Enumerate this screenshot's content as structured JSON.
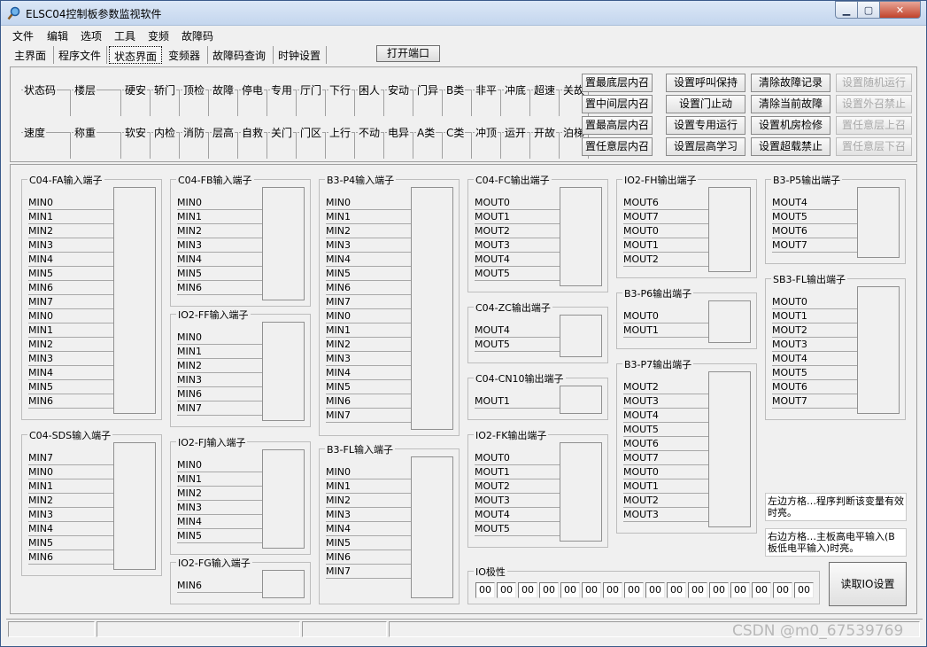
{
  "title": "ELSC04控制板参数监视软件",
  "menu": [
    "文件",
    "编辑",
    "选项",
    "工具",
    "变频",
    "故障码"
  ],
  "tabs": [
    "主界面",
    "程序文件",
    "状态界面",
    "变频器",
    "故障码查询",
    "时钟设置"
  ],
  "active_tab": "状态界面",
  "open_port": "打开端口",
  "status_row1": [
    "状态码",
    "楼层",
    "硬安",
    "轿门",
    "顶检",
    "故障",
    "停电",
    "专用",
    "厅门",
    "下行",
    "困人",
    "安动",
    "门异",
    "B类",
    "非平",
    "冲底",
    "超速",
    "关故"
  ],
  "status_row2": [
    "速度",
    "称重",
    "软安",
    "内检",
    "消防",
    "层高",
    "自救",
    "关门",
    "门区",
    "上行",
    "不动",
    "电异",
    "A类",
    "C类",
    "冲顶",
    "运开",
    "开故",
    "泊梯"
  ],
  "buttons_col1": [
    "置最底层内召",
    "置中间层内召",
    "置最高层内召",
    "置任意层内召"
  ],
  "buttons_col2": [
    "设置呼叫保持",
    "设置门止动",
    "设置专用运行",
    "设置层高学习"
  ],
  "buttons_col3": [
    "清除故障记录",
    "清除当前故障",
    "设置机房检修",
    "设置超载禁止"
  ],
  "buttons_col4": [
    "设置随机运行",
    "设置外召禁止",
    "置任意层上召",
    "置任意层下召"
  ],
  "groups": {
    "c04fa": {
      "title": "C04-FA输入端子",
      "pins": [
        "MIN0",
        "MIN1",
        "MIN2",
        "MIN3",
        "MIN4",
        "MIN5",
        "MIN6",
        "MIN7",
        "MIN0",
        "MIN1",
        "MIN2",
        "MIN3",
        "MIN4",
        "MIN5",
        "MIN6"
      ]
    },
    "c04sds": {
      "title": "C04-SDS输入端子",
      "pins": [
        "MIN7",
        "MIN0",
        "MIN1",
        "MIN2",
        "MIN3",
        "MIN4",
        "MIN5",
        "MIN6"
      ]
    },
    "c04fb": {
      "title": "C04-FB输入端子",
      "pins": [
        "MIN0",
        "MIN1",
        "MIN2",
        "MIN3",
        "MIN4",
        "MIN5",
        "MIN6"
      ]
    },
    "io2ff": {
      "title": "IO2-FF输入端子",
      "pins": [
        "MIN0",
        "MIN1",
        "MIN2",
        "MIN3",
        "MIN6",
        "MIN7"
      ]
    },
    "io2fj": {
      "title": "IO2-FJ输入端子",
      "pins": [
        "MIN0",
        "MIN1",
        "MIN2",
        "MIN3",
        "MIN4",
        "MIN5"
      ]
    },
    "io2fg": {
      "title": "IO2-FG输入端子",
      "pins": [
        "MIN6"
      ]
    },
    "b3p4": {
      "title": "B3-P4输入端子",
      "pins": [
        "MIN0",
        "MIN1",
        "MIN2",
        "MIN3",
        "MIN4",
        "MIN5",
        "MIN6",
        "MIN7",
        "MIN0",
        "MIN1",
        "MIN2",
        "MIN3",
        "MIN4",
        "MIN5",
        "MIN6",
        "MIN7"
      ]
    },
    "b3fl": {
      "title": "B3-FL输入端子",
      "pins": [
        "MIN0",
        "MIN1",
        "MIN2",
        "MIN3",
        "MIN4",
        "MIN5",
        "MIN6",
        "MIN7"
      ]
    },
    "c04fc": {
      "title": "C04-FC输出端子",
      "pins": [
        "MOUT0",
        "MOUT1",
        "MOUT2",
        "MOUT3",
        "MOUT4",
        "MOUT5"
      ]
    },
    "c04zc": {
      "title": "C04-ZC输出端子",
      "pins": [
        "MOUT4",
        "MOUT5"
      ]
    },
    "c04cn10": {
      "title": "C04-CN10输出端子",
      "pins": [
        "MOUT1"
      ]
    },
    "io2fk": {
      "title": "IO2-FK输出端子",
      "pins": [
        "MOUT0",
        "MOUT1",
        "MOUT2",
        "MOUT3",
        "MOUT4",
        "MOUT5"
      ]
    },
    "io2fh": {
      "title": "IO2-FH输出端子",
      "pins": [
        "MOUT6",
        "MOUT7",
        "MOUT0",
        "MOUT1",
        "MOUT2"
      ]
    },
    "b3p6": {
      "title": "B3-P6输出端子",
      "pins": [
        "MOUT0",
        "MOUT1"
      ]
    },
    "b3p7": {
      "title": "B3-P7输出端子",
      "pins": [
        "MOUT2",
        "MOUT3",
        "MOUT4",
        "MOUT5",
        "MOUT6",
        "MOUT7",
        "MOUT0",
        "MOUT1",
        "MOUT2",
        "MOUT3"
      ]
    },
    "b3p5": {
      "title": "B3-P5输出端子",
      "pins": [
        "MOUT4",
        "MOUT5",
        "MOUT6",
        "MOUT7"
      ]
    },
    "sb3fl": {
      "title": "SB3-FL输出端子",
      "pins": [
        "MOUT0",
        "MOUT1",
        "MOUT2",
        "MOUT3",
        "MOUT4",
        "MOUT5",
        "MOUT6",
        "MOUT7"
      ]
    }
  },
  "note1": "左边方格…程序判断该变量有效时亮。",
  "note2": "右边方格…主板高电平输入(B板低电平输入)时亮。",
  "io_polarity": {
    "title": "IO极性",
    "values": [
      "00",
      "00",
      "00",
      "00",
      "00",
      "00",
      "00",
      "00",
      "00",
      "00",
      "00",
      "00",
      "00",
      "00",
      "00",
      "00"
    ]
  },
  "read_io": "读取IO设置",
  "watermark": "CSDN @m0_67539769"
}
